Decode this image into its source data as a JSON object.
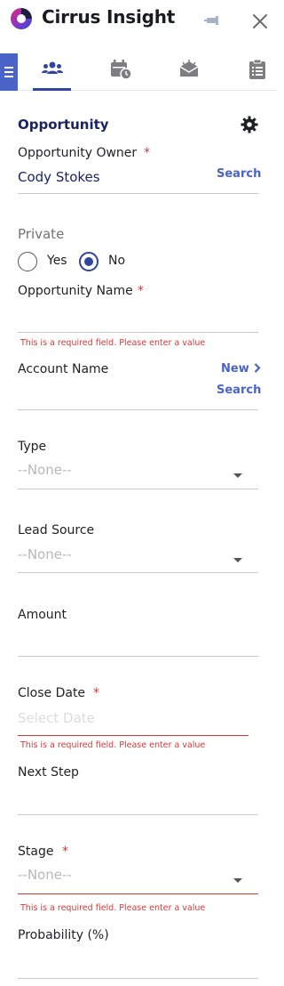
{
  "header": {
    "app_title": "Cirrus Insight"
  },
  "nav": {
    "tabs": [
      "contacts",
      "calendar",
      "email",
      "tasks"
    ],
    "active_tab": "contacts"
  },
  "form": {
    "section_title": "Opportunity",
    "owner": {
      "label": "Opportunity Owner",
      "required_mark": "*",
      "value": "Cody Stokes",
      "search_link": "Search"
    },
    "private": {
      "label": "Private",
      "yes_label": "Yes",
      "no_label": "No",
      "selected": "No"
    },
    "opportunity_name": {
      "label": "Opportunity Name",
      "required_mark": "*",
      "value": "",
      "error": "This is a required field. Please enter a value"
    },
    "account_name": {
      "label": "Account Name",
      "new_link": "New",
      "search_link": "Search"
    },
    "type": {
      "label": "Type",
      "value": "--None--"
    },
    "lead_source": {
      "label": "Lead Source",
      "value": "--None--"
    },
    "amount": {
      "label": "Amount",
      "value": ""
    },
    "close_date": {
      "label": "Close Date",
      "required_mark": "*",
      "placeholder": "Select Date",
      "error": "This is a required field. Please enter a value"
    },
    "next_step": {
      "label": "Next Step",
      "value": ""
    },
    "stage": {
      "label": "Stage",
      "required_mark": "*",
      "value": "--None--",
      "error": "This is a required field. Please enter a value"
    },
    "probability": {
      "label": "Probability (%)",
      "value": ""
    }
  },
  "colors": {
    "brand": "#4a63c7",
    "navy": "#1b2461",
    "error": "#d23a3a"
  }
}
